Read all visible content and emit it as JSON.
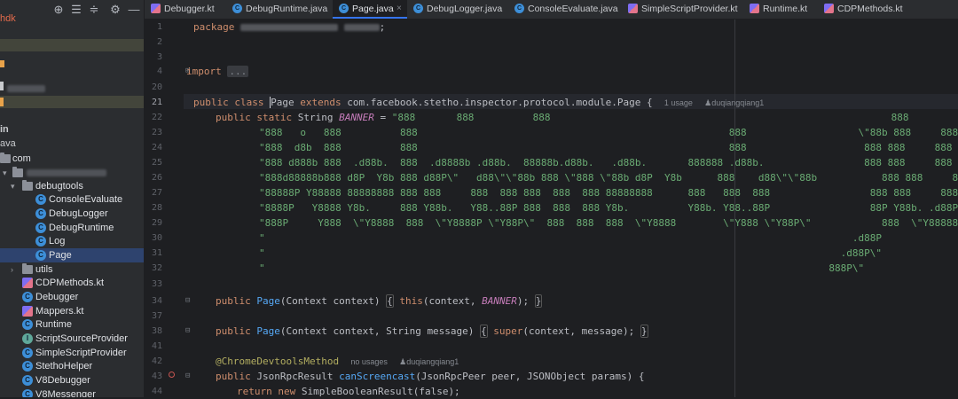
{
  "project_panel": {
    "fragments": [
      "hdk",
      "in",
      "ava",
      "com"
    ],
    "tree": [
      {
        "label": "debugtools",
        "kind": "folder",
        "expanded": true
      },
      {
        "label": "ConsoleEvaluate",
        "kind": "class"
      },
      {
        "label": "DebugLogger",
        "kind": "class"
      },
      {
        "label": "DebugRuntime",
        "kind": "class"
      },
      {
        "label": "Log",
        "kind": "class"
      },
      {
        "label": "Page",
        "kind": "class",
        "selected": true
      },
      {
        "label": "utils",
        "kind": "folder",
        "expanded": false
      },
      {
        "label": "CDPMethods.kt",
        "kind": "kt"
      },
      {
        "label": "Debugger",
        "kind": "class"
      },
      {
        "label": "Mappers.kt",
        "kind": "kt"
      },
      {
        "label": "Runtime",
        "kind": "class"
      },
      {
        "label": "ScriptSourceProvider",
        "kind": "class"
      },
      {
        "label": "SimpleScriptProvider",
        "kind": "class"
      },
      {
        "label": "StethoHelper",
        "kind": "class"
      },
      {
        "label": "V8Debugger",
        "kind": "class"
      },
      {
        "label": "V8Messenger",
        "kind": "class"
      }
    ]
  },
  "tabs": [
    {
      "label": "Debugger.kt",
      "type": "kt"
    },
    {
      "label": "DebugRuntime.java",
      "type": "class"
    },
    {
      "label": "Page.java",
      "type": "class",
      "active": true
    },
    {
      "label": "DebugLogger.java",
      "type": "class"
    },
    {
      "label": "ConsoleEvaluate.java",
      "type": "class"
    },
    {
      "label": "SimpleScriptProvider.kt",
      "type": "kt"
    },
    {
      "label": "Runtime.kt",
      "type": "kt"
    },
    {
      "label": "CDPMethods.kt",
      "type": "kt"
    }
  ],
  "line_numbers": [
    "1",
    "2",
    "3",
    "4",
    "20",
    "21",
    "22",
    "23",
    "24",
    "25",
    "26",
    "27",
    "28",
    "29",
    "30",
    "31",
    "32",
    "33",
    "34",
    "37",
    "38",
    "41",
    "42",
    "43",
    "44"
  ],
  "current_line": "21",
  "code": {
    "package_kw": "package",
    "import_kw": "import",
    "import_fold": "...",
    "l21": {
      "public_kw": "public",
      "class_kw": "class",
      "class_name": "Page",
      "extends_kw": "extends",
      "super_type": "com.facebook.stetho.inspector.protocol.module.Page",
      "brace": "{",
      "usages": "1 usage",
      "author": "duqiangqiang1"
    },
    "l22": {
      "mods": "public static",
      "type": "String",
      "name": "BANNER",
      "eq": "=",
      "str": "\"888       888          888                                                          888                  888888 88"
    },
    "banner": [
      "\"888   o   888          888                                                     888                   \\\"88b 888     888 888        \\n\"",
      "\"888  d8b  888          888                                                     888                    888 888     888 888        \\n\"",
      "\"888 d888b 888  .d88b.  888  .d8888b .d88b.  88888b.d88b.   .d88b.       888888 .d88b.                 888 888     888 8888888     \\n\"",
      "\"888d88888b888 d8P  Y8b 888 d88P\\\"   d88\\\"\\\"88b 888 \\\"888 \\\"88b d8P  Y8b      888    d88\\\"\\\"88b           888 888     888 888         \\n\"",
      "\"88888P Y88888 88888888 888 888     888  888 888  888  888 88888888      888   888  888                 888 888     888 888         \\n\"",
      "\"8888P   Y8888 Y8b.     888 Y88b.   Y88..88P 888  888  888 Y8b.          Y88b. Y88..88P                 88P Y88b. .d88P 888         \\n\"",
      "\"888P     Y888  \\\"Y8888  888  \\\"Y8888P \\\"Y88P\\\"  888  888  888  \\\"Y8888        \\\"Y888 \\\"Y88P\\\"            888  \\\"Y88888P\\\"  88888888 \\n\"",
      "\"                                                                                                    .d88P                        \\n\"",
      "\"                                                                                                  .d88P\\\"                         \\n\"",
      "\"                                                                                                888P\\\"                          \";"
    ],
    "l34": {
      "mods": "public",
      "name": "Page",
      "params": "(Context context)",
      "body_open": "{",
      "this_kw": "this",
      "args_a": "(context, ",
      "const": "BANNER",
      "args_b": ");",
      "body_close": "}"
    },
    "l37": {
      "mods": "public",
      "name": "Page",
      "params": "(Context context, String message)",
      "body_open": "{",
      "super_kw": "super",
      "args": "(context, message);",
      "body_close": "}"
    },
    "l41": {
      "annotation": "@ChromeDevtoolsMethod",
      "usages": "no usages",
      "author": "duqiangqiang1"
    },
    "l42": {
      "mods": "public",
      "type": "JsonRpcResult",
      "name": "canScreencast",
      "params": "(JsonRpcPeer peer, JSONObject params)",
      "brace": "{"
    },
    "l43": {
      "return_kw": "return",
      "new_kw": "new",
      "rest": "SimpleBooleanResult(false);"
    }
  }
}
